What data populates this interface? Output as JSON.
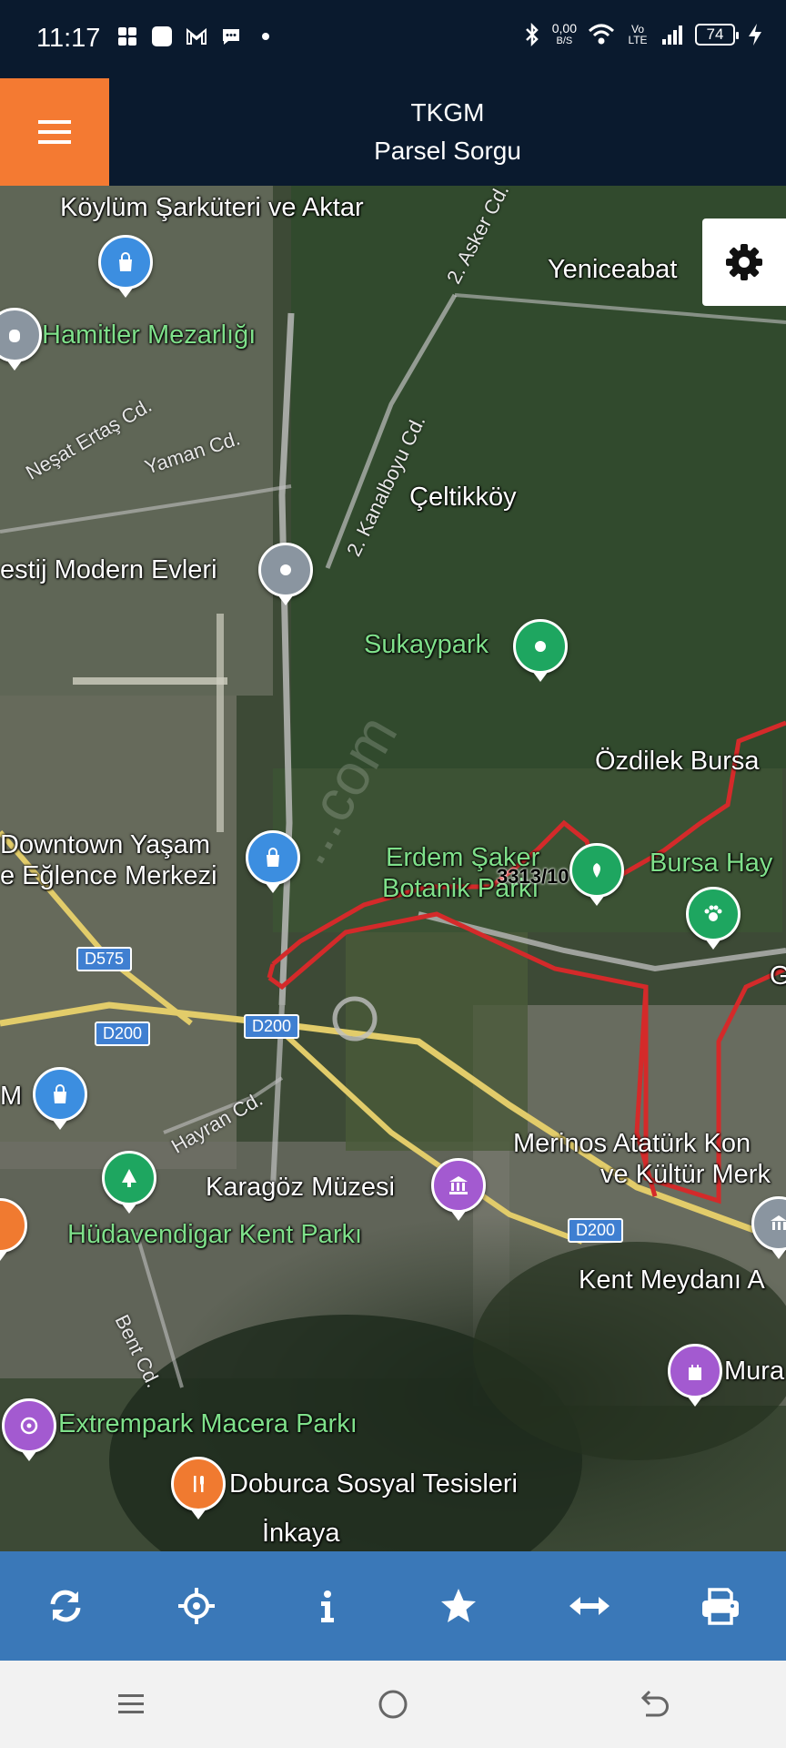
{
  "status_bar": {
    "time": "11:17",
    "net_speed_value": "0,00",
    "net_speed_unit": "B/S",
    "volte": "Vo LTE",
    "battery": "74",
    "icons": [
      "grid-app-icon",
      "square-app-icon",
      "gmail-icon",
      "chat-icon",
      "dot-icon",
      "bluetooth-icon",
      "wifi-icon",
      "signal-icon",
      "charging-icon"
    ]
  },
  "header": {
    "title": "TKGM",
    "subtitle": "Parsel Sorgu",
    "menu_color": "#f47a32",
    "bg_color": "#0a1a2e"
  },
  "map": {
    "parcel_label": "3313/10",
    "watermark": "...com",
    "places": [
      "Köylüm Şarküteri ve Aktar",
      "Hamitler Mezarlığı",
      "Yeniceabat",
      "Çeltikköy",
      "estij Modern Evleri",
      "Sukaypark",
      "Özdilek Bursa",
      "Downtown Yaşam",
      "e Eğlence Merkezi",
      "Erdem Şaker",
      "Botanik Parkı",
      "Bursa Hay",
      "M",
      "Karagöz Müzesi",
      "Merinos Atatürk Kon",
      "ve Kültür Merk",
      "Hüdavendigar Kent Parkı",
      "Kent Meydanı A",
      "Mura",
      "Extrempark Macera Parkı",
      "Doburca Sosyal Tesisleri",
      "İnkaya",
      "G"
    ],
    "roads": [
      "2. Asker Cd.",
      "Neşat Ertaş Cd.",
      "Yaman Cd.",
      "2. Kanalboyu Cd.",
      "Hayran Cd.",
      "Bent Cd."
    ],
    "highway_shields": [
      "D575",
      "D200",
      "D200",
      "D200"
    ],
    "parcel_color": "#d42a2a"
  },
  "toolbar": {
    "buttons": [
      "refresh-icon",
      "locate-icon",
      "info-icon",
      "star-icon",
      "measure-icon",
      "print-icon"
    ],
    "bg_color": "#3a78b8"
  },
  "navbar": {
    "buttons": [
      "recent-apps-icon",
      "home-icon",
      "back-icon"
    ]
  }
}
